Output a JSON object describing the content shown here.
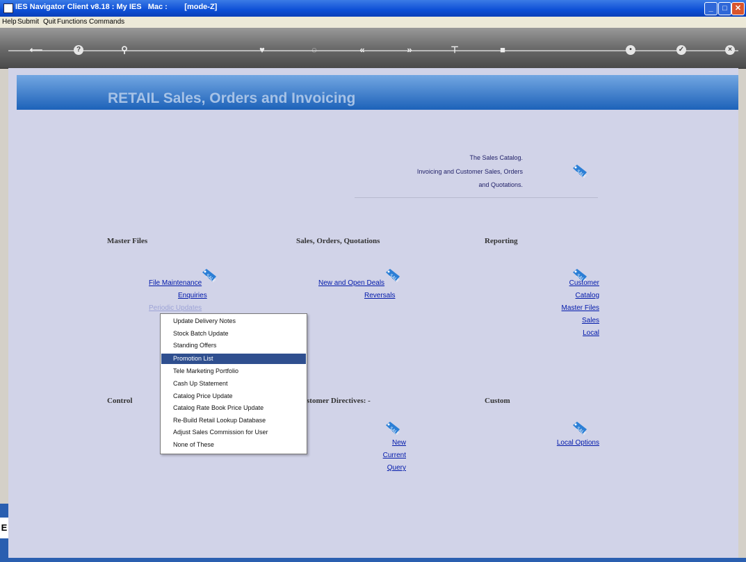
{
  "window": {
    "title": "IES Navigator Client v8.18 : My IES   Mac :        [mode-Z]"
  },
  "menubar": {
    "items": [
      "Help",
      "Submit",
      "Quit",
      "Functions",
      "Commands"
    ]
  },
  "banner": {
    "title": "RETAIL Sales, Orders and Invoicing"
  },
  "catalog": {
    "lines": [
      "The Sales Catalog.",
      "Invoicing and Customer Sales, Orders",
      "and Quotations."
    ]
  },
  "sections": {
    "master_files": {
      "heading": "Master Files",
      "links": [
        "File Maintenance",
        "Enquiries",
        "Periodic Updates"
      ]
    },
    "sales": {
      "heading": "Sales, Orders, Quotations",
      "links": [
        "New and Open Deals",
        "Reversals"
      ]
    },
    "reporting": {
      "heading": "Reporting",
      "links": [
        "Customer",
        "Catalog",
        "Master Files",
        "Sales",
        "Local"
      ]
    },
    "control": {
      "heading": "Control"
    },
    "directives": {
      "heading": "stomer Directives: -",
      "links": [
        "New",
        "Current",
        "Query"
      ]
    },
    "custom": {
      "heading": "Custom",
      "links": [
        "Local Options"
      ]
    }
  },
  "popup_menu": {
    "items": [
      "Update Delivery Notes",
      "Stock Batch Update",
      "Standing Offers",
      "Promotion List",
      "Tele Marketing Portfolio",
      "Cash Up Statement",
      "Catalog Price Update",
      "Catalog Rate Book Price Update",
      "Re-Build Retail Lookup Database",
      "Adjust Sales Commission for User",
      "None of These"
    ],
    "selected": "Promotion List"
  },
  "colors": {
    "accent": "#1d62b9",
    "link": "#0018aa",
    "selection": "#2f4f8f"
  },
  "icons": [
    "sale-tag-icon"
  ]
}
